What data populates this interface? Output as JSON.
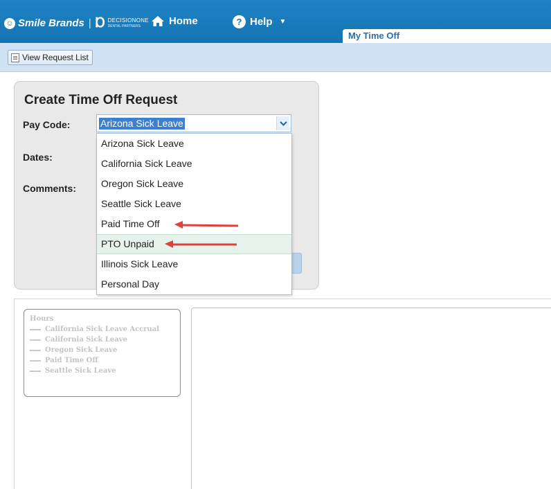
{
  "header": {
    "brand_name": "Smile Brands",
    "partner_logo_big": "DECISIONONE",
    "partner_logo_small": "DENTAL PARTNERS",
    "nav_home": "Home",
    "nav_help": "Help",
    "active_tab": "My Time Off",
    "colors": {
      "bar": "#1573b3",
      "toolbar": "#cfe3f4"
    }
  },
  "toolbar": {
    "view_request_list": "View Request List"
  },
  "form": {
    "title": "Create Time Off Request",
    "pay_code_label": "Pay Code:",
    "dates_label": "Dates:",
    "comments_label": "Comments:",
    "pay_code_selected": "Arizona Sick Leave",
    "options": [
      "Arizona Sick Leave",
      "California Sick Leave",
      "Oregon Sick Leave",
      "Seattle Sick Leave",
      "Paid Time Off",
      "PTO Unpaid",
      "Illinois Sick Leave",
      "Personal Day"
    ],
    "highlighted_option": "PTO Unpaid",
    "annotation_color": "#e0403a"
  },
  "legend": {
    "title": "Hours",
    "items": [
      "California Sick Leave Accrual",
      "California Sick Leave",
      "Oregon Sick Leave",
      "Paid Time Off",
      "Seattle Sick Leave"
    ]
  }
}
